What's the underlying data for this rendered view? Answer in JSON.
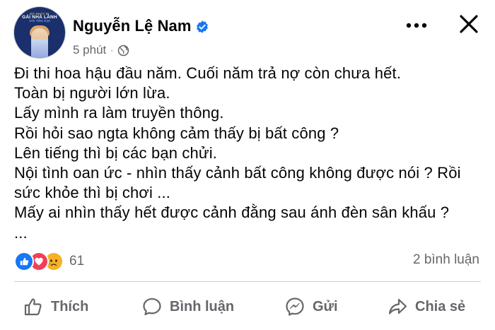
{
  "header": {
    "avatar": {
      "banner_line1": "ĐÃ NHẬT BỊ",
      "banner_line2": "GÁI NHÀ LÀNH",
      "banner_line3": "VỚI TÊN GỌI"
    },
    "name": "Nguyễn Lệ Nam",
    "verified": true,
    "time": "5 phút",
    "separator": "·",
    "privacy_icon": "globe-icon"
  },
  "post": {
    "lines": [
      "Đi thi hoa hậu đầu năm. Cuối năm trả nợ còn chưa hết.",
      "Toàn bị người lớn lừa.",
      "Lấy mình ra làm truyền thông.",
      "Rồi hỏi sao ngta không cảm thấy bị bất công ?",
      "Lên tiếng thì bị các bạn chửi.",
      "Nội tình oan ức - nhìn thấy cảnh bất công không được nói ? Rồi",
      "sức khỏe thì bị chơi ...",
      "Mấy ai nhìn thấy hết được cảnh đằng sau ánh đèn sân khấu ?",
      "..."
    ]
  },
  "stats": {
    "reaction_icons": [
      "like-icon",
      "love-icon",
      "sad-icon"
    ],
    "reaction_count": "61",
    "comment_count": "2 bình luận"
  },
  "actions": {
    "like": "Thích",
    "comment": "Bình luận",
    "send": "Gửi",
    "share": "Chia sẻ"
  },
  "colors": {
    "brand_blue": "#1877f2",
    "love_red": "#f33e58",
    "sad_yellow": "#f7b125",
    "secondary_text": "#65676b"
  }
}
